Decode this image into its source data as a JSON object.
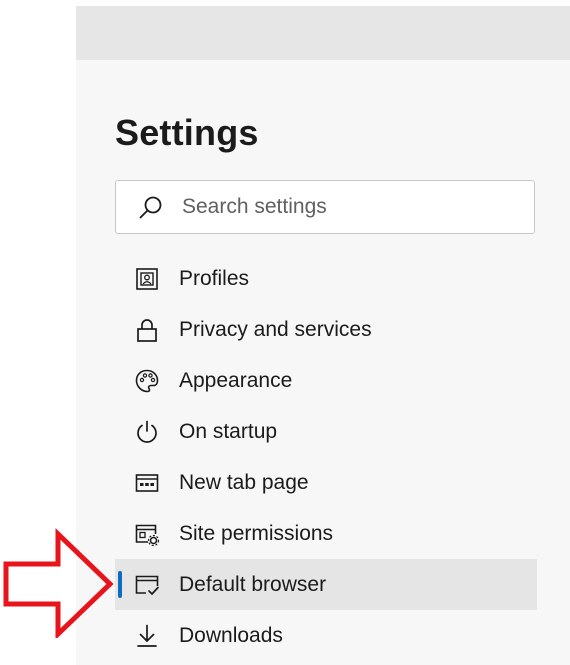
{
  "header": {
    "title": "Settings"
  },
  "search": {
    "placeholder": "Search settings",
    "icon": "search-icon"
  },
  "nav": {
    "items": [
      {
        "label": "Profiles",
        "icon": "profile-icon",
        "active": false
      },
      {
        "label": "Privacy and services",
        "icon": "lock-icon",
        "active": false
      },
      {
        "label": "Appearance",
        "icon": "palette-icon",
        "active": false
      },
      {
        "label": "On startup",
        "icon": "power-icon",
        "active": false
      },
      {
        "label": "New tab page",
        "icon": "new-tab-page-icon",
        "active": false
      },
      {
        "label": "Site permissions",
        "icon": "site-permissions-icon",
        "active": false
      },
      {
        "label": "Default browser",
        "icon": "default-browser-icon",
        "active": true
      },
      {
        "label": "Downloads",
        "icon": "download-icon",
        "active": false
      }
    ]
  },
  "colors": {
    "accent": "#0f6cbd",
    "annotation_arrow": "#e8141b",
    "active_bg": "#e5e5e5"
  }
}
